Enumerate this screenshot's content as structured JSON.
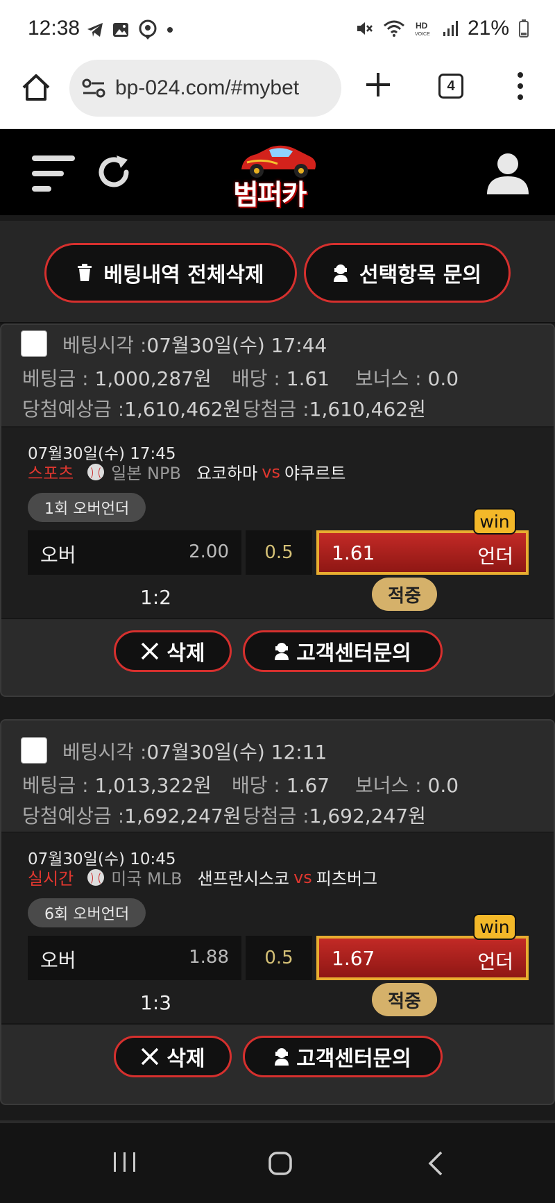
{
  "status_bar": {
    "time": "12:38",
    "battery": "21%",
    "icons": [
      "telegram-icon",
      "gallery-icon",
      "map-pin-icon",
      "dot-icon",
      "mute-icon",
      "wifi-icon",
      "hd-voice-icon",
      "signal-icon",
      "battery-icon"
    ]
  },
  "browser": {
    "url": "bp-024.com/#mybet",
    "tab_count": "4"
  },
  "header": {
    "logo_text": "범퍼카"
  },
  "top_actions": {
    "delete_all": "베팅내역 전체삭제",
    "inquire_selected": "선택항목 문의"
  },
  "bets": [
    {
      "bet_time_label": "베팅시각 :",
      "bet_time": "07월30일(수) 17:44",
      "stake_label": "베팅금 :",
      "stake": "1,000,287원",
      "odds_label": "배당 :",
      "odds": "1.61",
      "bonus_label": "보너스 :",
      "bonus": "0.0",
      "expected_label": "당첨예상금 :",
      "expected": "1,610,462원",
      "won_label": "당첨금 :",
      "won": "1,610,462원",
      "game": {
        "time": "07월30일(수) 17:45",
        "category": "스포츠",
        "league": "일본 NPB",
        "home": "요코하마",
        "vs": "vs",
        "away": "야쿠르트",
        "market": "1회 오버언더",
        "over_label": "오버",
        "over_odds": "2.00",
        "line": "0.5",
        "under_odds": "1.61",
        "under_label": "언더",
        "win_badge": "win",
        "score": "1:2",
        "result": "적중"
      },
      "delete_label": "삭제",
      "cs_label": "고객센터문의"
    },
    {
      "bet_time_label": "베팅시각 :",
      "bet_time": "07월30일(수) 12:11",
      "stake_label": "베팅금 :",
      "stake": "1,013,322원",
      "odds_label": "배당 :",
      "odds": "1.67",
      "bonus_label": "보너스 :",
      "bonus": "0.0",
      "expected_label": "당첨예상금 :",
      "expected": "1,692,247원",
      "won_label": "당첨금 :",
      "won": "1,692,247원",
      "game": {
        "time": "07월30일(수) 10:45",
        "category": "실시간",
        "league": "미국 MLB",
        "home": "샌프란시스코",
        "vs": "vs",
        "away": "피츠버그",
        "market": "6회 오버언더",
        "over_label": "오버",
        "over_odds": "1.88",
        "line": "0.5",
        "under_odds": "1.67",
        "under_label": "언더",
        "win_badge": "win",
        "score": "1:3",
        "result": "적중"
      },
      "delete_label": "삭제",
      "cs_label": "고객센터문의"
    }
  ],
  "colors": {
    "accent_red": "#d6302e",
    "win_gold": "#e8ad30",
    "hit_badge": "#d5b16a"
  }
}
